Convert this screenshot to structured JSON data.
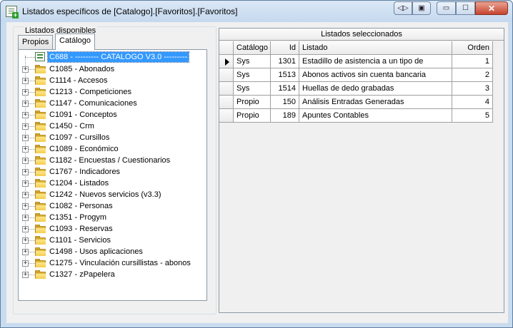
{
  "window": {
    "title": "Listados específicos de [Catalogo].[Favoritos].[Favoritos]",
    "buttons": {
      "extra1": "◁▷",
      "extra2": "▣",
      "minimize": "▭",
      "maximize": "☐",
      "close": "✕"
    }
  },
  "left": {
    "group_label": "Listados disponibles",
    "tabs": [
      "Propios",
      "Catálogo"
    ],
    "root_label": "C688 - --------- CATALOGO V3.0 ---------",
    "items": [
      "C1085 - Abonados",
      "C1114 - Accesos",
      "C1213 - Competiciones",
      "C1147 - Comunicaciones",
      "C1091 - Conceptos",
      "C1450 - Crm",
      "C1097 - Cursillos",
      "C1089 - Económico",
      "C1182 - Encuestas / Cuestionarios",
      "C1767 - Indicadores",
      "C1204 - Listados",
      "C1242 - Nuevos servicios (v3.3)",
      "C1082 - Personas",
      "C1351 - Progym",
      "C1093 - Reservas",
      "C1101 - Servicios",
      "C1498 - Usos aplicaciones",
      "C1275 - Vinculación cursillistas - abonos",
      "C1327 - zPapelera"
    ]
  },
  "right": {
    "header": "Listados seleccionados",
    "columns": [
      "Catálogo",
      "Id",
      "Listado",
      "Orden"
    ],
    "rows": [
      {
        "catalogo": "Sys",
        "id": "1301",
        "listado": "Estadillo de asistencia a un tipo de",
        "orden": "1"
      },
      {
        "catalogo": "Sys",
        "id": "1513",
        "listado": "Abonos activos sin cuenta bancaria",
        "orden": "2"
      },
      {
        "catalogo": "Sys",
        "id": "1514",
        "listado": "Huellas de dedo grabadas",
        "orden": "3"
      },
      {
        "catalogo": "Propio",
        "id": "150",
        "listado": "Análisis Entradas Generadas",
        "orden": "4"
      },
      {
        "catalogo": "Propio",
        "id": "189",
        "listado": "Apuntes Contables",
        "orden": "5"
      }
    ]
  },
  "colors": {
    "selection": "#3399ff",
    "folder": "#f4cd4e",
    "titlebar": "#c9dcef"
  }
}
